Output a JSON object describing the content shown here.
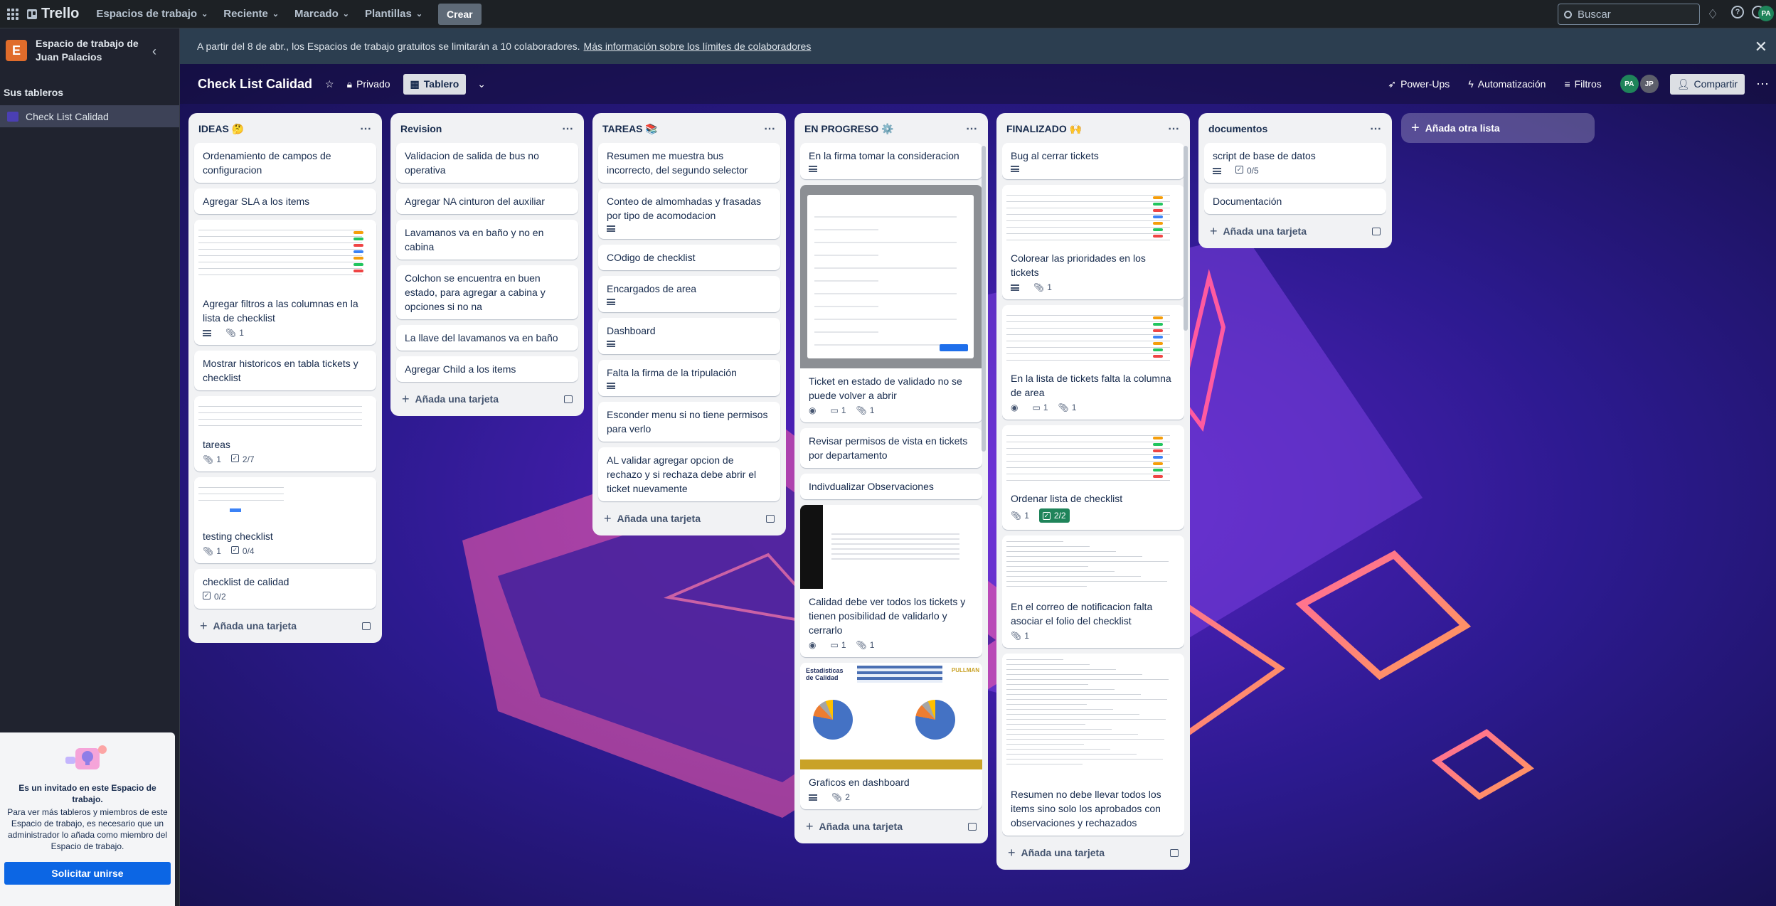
{
  "topbar": {
    "brand": "Trello",
    "nav": [
      "Espacios de trabajo",
      "Reciente",
      "Marcado",
      "Plantillas"
    ],
    "create_label": "Crear",
    "search_placeholder": "Buscar",
    "user_initials": "PA"
  },
  "sidebar": {
    "workspace_initial": "E",
    "workspace_name": "Espacio de trabajo de Juan Palacios",
    "boards_title": "Sus tableros",
    "boards": [
      "Check List Calidad"
    ],
    "invite": {
      "title": "Es un invitado en este Espacio de trabajo.",
      "text": "Para ver más tableros y miembros de este Espacio de trabajo, es necesario que un administrador lo añada como miembro del Espacio de trabajo.",
      "button": "Solicitar unirse"
    }
  },
  "banner": {
    "text": "A partir del 8 de abr., los Espacios de trabajo gratuitos se limitarán a 10 colaboradores.",
    "link": "Más información sobre los límites de colaboradores"
  },
  "board": {
    "title": "Check List Calidad",
    "visibility": "Privado",
    "view": "Tablero",
    "actions": [
      "Power-Ups",
      "Automatización",
      "Filtros"
    ],
    "members": [
      "PA",
      "JP"
    ],
    "share": "Compartir"
  },
  "add_card_label": "Añada una tarjeta",
  "add_list_label": "Añada otra lista",
  "lists": [
    {
      "title": "IDEAS 🤔",
      "cards": [
        {
          "title": "Ordenamiento de campos de configuracion"
        },
        {
          "title": "Agregar SLA a los items"
        },
        {
          "title": "Agregar filtros a las columnas en la lista de checklist",
          "cover": "table",
          "desc": true,
          "attach": "1"
        },
        {
          "title": "Mostrar historicos en tabla tickets y checklist"
        },
        {
          "title": "tareas",
          "cover": "light",
          "attach": "1",
          "check": "2/7"
        },
        {
          "title": "testing checklist",
          "cover": "form",
          "attach": "1",
          "check": "0/4"
        },
        {
          "title": "checklist de calidad",
          "check": "0/2"
        }
      ]
    },
    {
      "title": "Revision",
      "cards": [
        {
          "title": "Validacion de salida de bus no operativa"
        },
        {
          "title": "Agregar NA cinturon del auxiliar"
        },
        {
          "title": "Lavamanos va en baño y no en cabina"
        },
        {
          "title": "Colchon se encuentra en buen estado, para agregar a cabina y opciones si no na"
        },
        {
          "title": "La llave del lavamanos va en baño"
        },
        {
          "title": "Agregar Child a los items"
        }
      ]
    },
    {
      "title": "TAREAS 📚",
      "cards": [
        {
          "title": "Resumen me muestra bus incorrecto, del segundo selector"
        },
        {
          "title": "Conteo de almomhadas y frasadas por tipo de acomodacion",
          "desc": true
        },
        {
          "title": "COdigo de checklist"
        },
        {
          "title": "Encargados de area",
          "desc": true
        },
        {
          "title": "Dashboard",
          "desc": true
        },
        {
          "title": "Falta la firma de la tripulación",
          "desc": true
        },
        {
          "title": "Esconder menu si no tiene permisos para verlo"
        },
        {
          "title": "AL validar agregar opcion de rechazo y si rechaza debe abrir el ticket nuevamente"
        }
      ]
    },
    {
      "title": "EN PROGRESO ⚙️",
      "cards": [
        {
          "title": "En la firma tomar la consideracion",
          "desc": true
        },
        {
          "title": "Ticket en estado de validado no se puede volver a abrir",
          "cover": "modal",
          "watch": true,
          "comments": "1",
          "attach": "1"
        },
        {
          "title": "Revisar permisos de vista en tickets por departamento"
        },
        {
          "title": "Indivdualizar Observaciones"
        },
        {
          "title": "Calidad debe ver todos los tickets y tienen posibilidad de validarlo y cerrarlo",
          "cover": "dark",
          "watch": true,
          "comments": "1",
          "attach": "1"
        },
        {
          "title": "Graficos en dashboard",
          "cover": "stats",
          "desc": true,
          "attach": "2"
        }
      ]
    },
    {
      "title": "FINALIZADO 🙌",
      "cards": [
        {
          "title": "Bug al cerrar tickets",
          "desc": true
        },
        {
          "title": "Colorear las prioridades en los tickets",
          "cover": "table2",
          "desc": true,
          "attach": "1"
        },
        {
          "title": "En la lista de tickets falta la columna de area",
          "cover": "table2",
          "watch": true,
          "comments": "1",
          "attach": "1"
        },
        {
          "title": "Ordenar lista de checklist",
          "cover": "table2",
          "attach": "1",
          "check_done": "2/2"
        },
        {
          "title": "En el correo de notificacion falta asociar el folio del checklist",
          "cover": "doc",
          "attach": "1"
        },
        {
          "title": "Resumen no debe llevar todos los items sino solo los aprobados con observaciones y rechazados",
          "cover": "doc2"
        }
      ]
    },
    {
      "title": "documentos",
      "cards": [
        {
          "title": "script de base de datos",
          "desc": true,
          "check": "0/5"
        },
        {
          "title": "Documentación"
        }
      ]
    }
  ],
  "stats_cover": {
    "heading": "Estadísticas de Calidad",
    "brand": "PULLMAN"
  },
  "colors": {
    "topbar": "#1d2125",
    "sidebar": "#20232f",
    "banner": "#2c3e50",
    "list": "#f1f2f4",
    "accent": "#0c66e4",
    "done": "#1f845a"
  }
}
